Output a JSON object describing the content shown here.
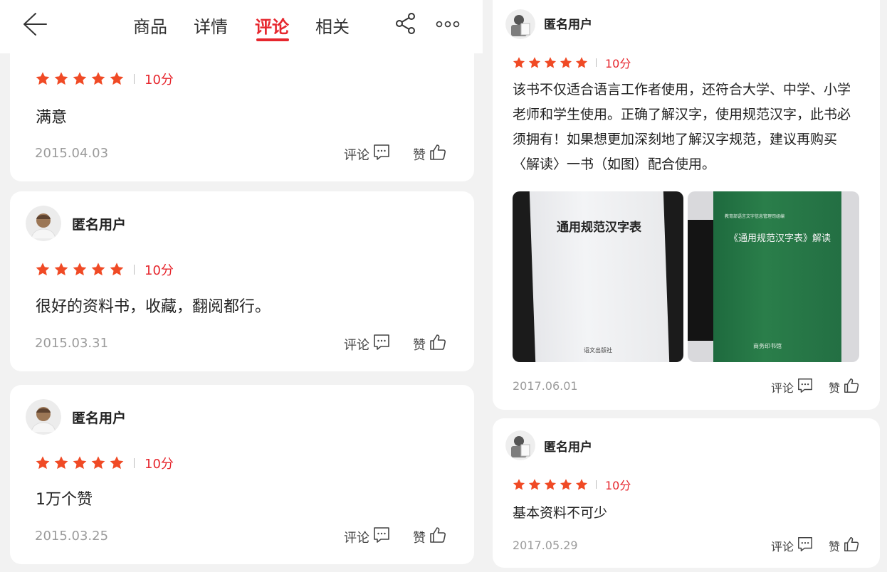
{
  "header": {
    "tabs": [
      "商品",
      "详情",
      "评论",
      "相关"
    ],
    "active_tab": "评论",
    "back_icon": "back-arrow-icon",
    "share_icon": "share-icon",
    "more_icon": "more-icon"
  },
  "colors": {
    "accent": "#e6262d",
    "star": "#f04a25",
    "background": "#f2f2f2"
  },
  "action_labels": {
    "comment": "评论",
    "like": "赞"
  },
  "reviews_left": [
    {
      "user": "",
      "rating": 5,
      "score": "10分",
      "text": "满意",
      "date": "2015.04.03"
    },
    {
      "user": "匿名用户",
      "rating": 5,
      "score": "10分",
      "text": "很好的资料书，收藏，翻阅都行。",
      "date": "2015.03.31"
    },
    {
      "user": "匿名用户",
      "rating": 5,
      "score": "10分",
      "text": "1万个赞",
      "date": "2015.03.25"
    }
  ],
  "reviews_right": [
    {
      "user": "匿名用户",
      "rating": 5,
      "score": "10分",
      "text": "该书不仅适合语言工作者使用，还符合大学、中学、小学老师和学生使用。正确了解汉字，使用规范汉字，此书必须拥有！如果想更加深刻地了解汉字规范，建议再购买〈解读〉一书（如图）配合使用。",
      "date": "2017.06.01",
      "photos": [
        {
          "book_title": "通用规范汉字表",
          "publisher": "语文出版社"
        },
        {
          "book_title": "《通用规范汉字表》解读",
          "series": "教育部语言文字信息管理司组编",
          "publisher": "商务印书馆"
        }
      ]
    },
    {
      "user": "匿名用户",
      "rating": 5,
      "score": "10分",
      "text": "基本资料不可少",
      "date": "2017.05.29"
    }
  ]
}
